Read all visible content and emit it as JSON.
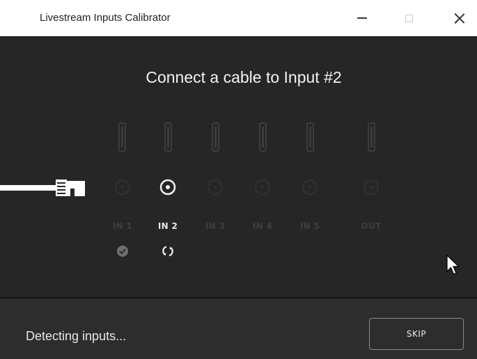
{
  "window": {
    "title": "Livestream Inputs Calibrator",
    "controls": {
      "minimize_icon": "minimize-icon",
      "maximize_icon": "maximize-icon",
      "close_icon": "close-icon"
    }
  },
  "main": {
    "heading": "Connect a cable to Input #2",
    "ports": [
      {
        "label": "IN 1",
        "state": "done",
        "led": "dim"
      },
      {
        "label": "IN 2",
        "state": "detecting",
        "led": "active"
      },
      {
        "label": "IN 3",
        "state": "pending",
        "led": "dim"
      },
      {
        "label": "IN 4",
        "state": "pending",
        "led": "dim"
      },
      {
        "label": "IN 5",
        "state": "pending",
        "led": "dim"
      },
      {
        "label": "OUT",
        "state": "pending",
        "led": "dim"
      }
    ],
    "icons": {
      "port": "hdmi-port-icon",
      "led": "led-indicator-icon",
      "done": "check-circle-icon",
      "detecting": "refresh-icon",
      "cable": "hdmi-cable-icon",
      "cursor": "mouse-pointer-icon"
    }
  },
  "footer": {
    "status": "Detecting inputs...",
    "skip_label": "SKIP"
  },
  "colors": {
    "background": "#262626",
    "footer_background": "#2d2d2d",
    "active": "#f2f2f2",
    "inactive": "#3e3e3e",
    "done": "#707070"
  }
}
